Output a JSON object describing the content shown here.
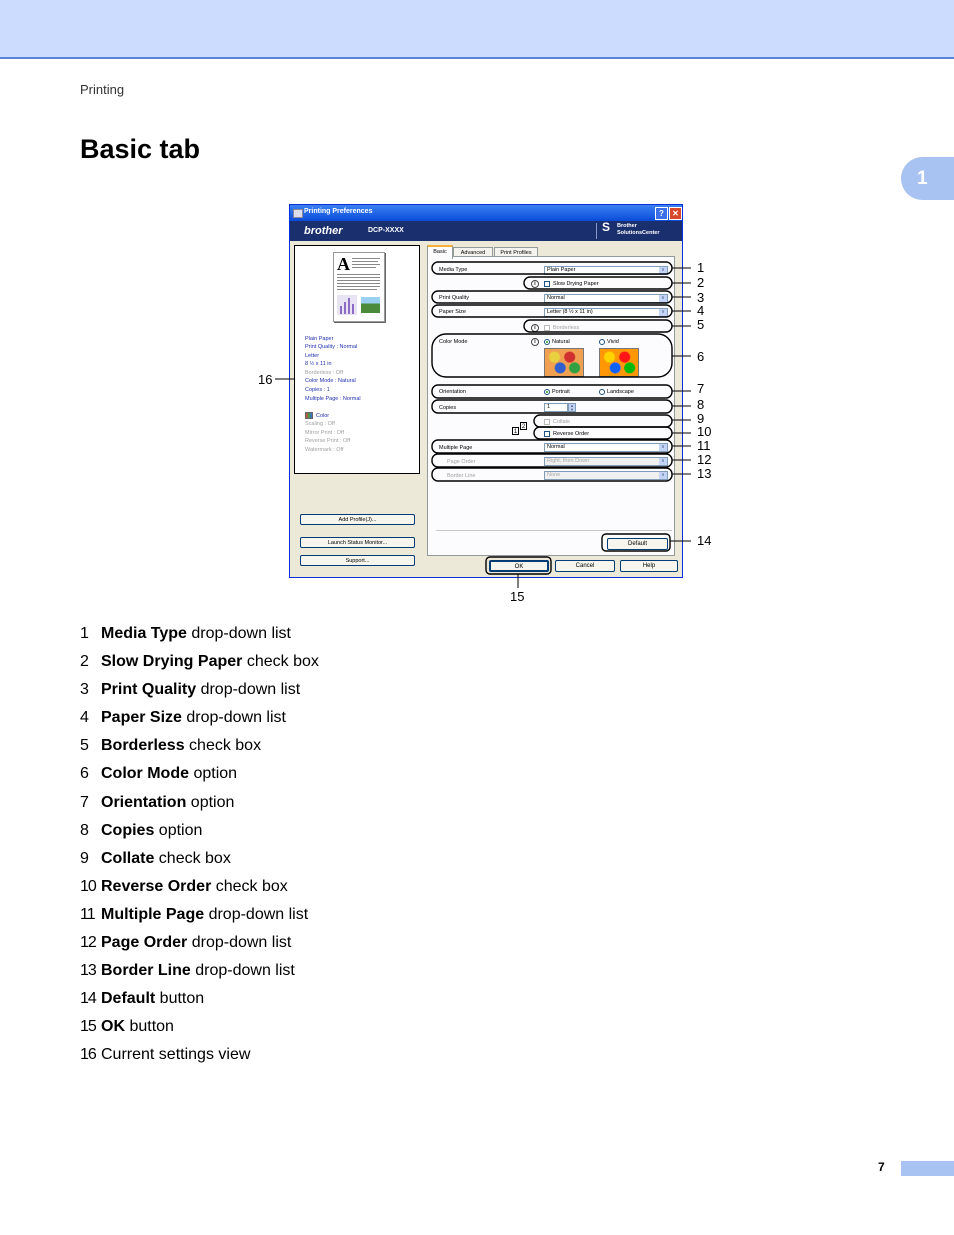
{
  "header": {
    "section": "Printing",
    "title": "Basic tab",
    "chapter_tab": "1"
  },
  "footer": {
    "page_number": "7"
  },
  "dialog": {
    "title": "Printing Preferences",
    "help_glyph": "?",
    "close_glyph": "✕",
    "brand": "brother",
    "model": "DCP-XXXX",
    "solutions_line1": "Brother",
    "solutions_line2": "SolutionsCenter",
    "settings_view": {
      "paper_lines": [
        "Plain Paper",
        "Print Quality : Normal",
        "Letter",
        "8 ½ x 11 in"
      ],
      "gray_lines": [
        "Borderless : Off"
      ],
      "blue_lines2": [
        "Color Mode : Natural",
        "Copies : 1",
        "Multiple Page : Normal"
      ],
      "color_label": "Color",
      "gray_lines2": [
        "Scaling : Off",
        "Mirror Print : Off",
        "Reverse Print : Off",
        "Watermark : Off"
      ]
    },
    "left_buttons": [
      "Add Profile(J)...",
      "Launch Status Monitor...",
      "Support..."
    ],
    "tabs": [
      "Basic",
      "Advanced",
      "Print Profiles"
    ],
    "fields": {
      "media_type": {
        "label": "Media Type",
        "value": "Plain Paper"
      },
      "slow_drying": {
        "label": "Slow Drying Paper"
      },
      "print_quality": {
        "label": "Print Quality",
        "value": "Normal"
      },
      "paper_size": {
        "label": "Paper Size",
        "value": "Letter (8 ½ x 11 in)"
      },
      "borderless": {
        "label": "Borderless"
      },
      "color_mode": {
        "label": "Color Mode",
        "natural": "Natural",
        "vivid": "Vivid"
      },
      "orientation": {
        "label": "Orientation",
        "portrait": "Portrait",
        "landscape": "Landscape"
      },
      "copies": {
        "label": "Copies",
        "value": "1"
      },
      "collate": {
        "label": "Collate"
      },
      "collate_icon": [
        "1",
        "2"
      ],
      "reverse_order": {
        "label": "Reverse Order"
      },
      "multiple_page": {
        "label": "Multiple Page",
        "value": "Normal"
      },
      "page_order": {
        "label": "Page Order",
        "value": "Right, then Down"
      },
      "border_line": {
        "label": "Border Line",
        "value": "None"
      }
    },
    "info_glyph": "i",
    "arrow_glyph": "∨",
    "default_button": "Default",
    "ok_button": "OK",
    "cancel_button": "Cancel",
    "help_button": "Help"
  },
  "callouts": [
    "1",
    "2",
    "3",
    "4",
    "5",
    "6",
    "7",
    "8",
    "9",
    "10",
    "11",
    "12",
    "13",
    "14",
    "15",
    "16"
  ],
  "legend": [
    {
      "num": "1",
      "bold": "Media Type",
      "rest": " drop-down list"
    },
    {
      "num": "2",
      "bold": "Slow Drying Paper",
      "rest": " check box"
    },
    {
      "num": "3",
      "bold": "Print Quality",
      "rest": " drop-down list"
    },
    {
      "num": "4",
      "bold": "Paper Size",
      "rest": " drop-down list"
    },
    {
      "num": "5",
      "bold": "Borderless",
      "rest": " check box"
    },
    {
      "num": "6",
      "bold": "Color Mode",
      "rest": " option"
    },
    {
      "num": "7",
      "bold": "Orientation",
      "rest": " option"
    },
    {
      "num": "8",
      "bold": "Copies",
      "rest": " option"
    },
    {
      "num": "9",
      "bold": "Collate",
      "rest": " check box"
    },
    {
      "num": "10",
      "bold": "Reverse Order",
      "rest": " check box"
    },
    {
      "num": "11",
      "bold": "Multiple Page",
      "rest": " drop-down list"
    },
    {
      "num": "12",
      "bold": "Page Order",
      "rest": " drop-down list"
    },
    {
      "num": "13",
      "bold": "Border Line",
      "rest": " drop-down list"
    },
    {
      "num": "14",
      "bold": "Default",
      "rest": " button"
    },
    {
      "num": "15",
      "bold": "OK",
      "rest": " button"
    },
    {
      "num": "16",
      "bold": "",
      "rest": "Current settings view"
    }
  ]
}
